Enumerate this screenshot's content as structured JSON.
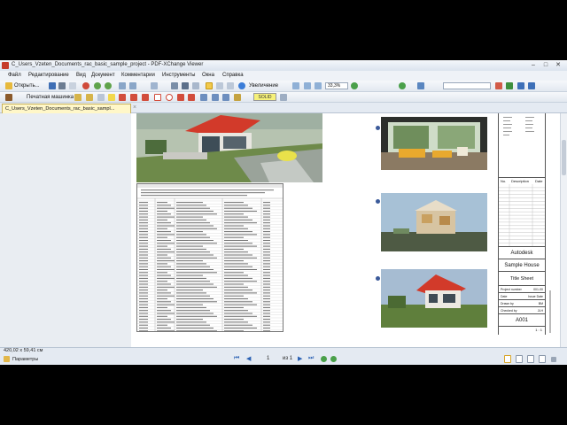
{
  "window": {
    "title": "C_Users_Vzeten_Documents_rac_basic_sample_project - PDF-XChange Viewer",
    "minimize": "–",
    "maximize": "□",
    "close": "✕"
  },
  "menu": [
    "Файл",
    "Редактирование",
    "Вид",
    "Документ",
    "Комментарии",
    "Инструменты",
    "Окна",
    "Справка"
  ],
  "toolbar": {
    "open_label": "Открыть...",
    "zoom_label": "Увеличение",
    "zoom_value": "33,3%",
    "typewriter_label": "Печатная машинка",
    "solid_label": "SOLID"
  },
  "tab": {
    "label": "C_Users_Vzeten_Documents_rac_basic_sampl...",
    "close": "×"
  },
  "titleblock": {
    "company": "Autodesk",
    "project": "Sample House",
    "sheet_title": "Title Sheet",
    "project_number_label": "Project number",
    "project_number": "001-00",
    "date_label": "Date",
    "date": "Issue Date",
    "drawn_by_label": "Drawn by",
    "drawn_by": "BM",
    "checked_by_label": "Checked by",
    "checked_by": "JLH",
    "sheet_number": "A001",
    "scale": "1 : 1",
    "revision_headers": [
      "No.",
      "Description",
      "Date"
    ]
  },
  "status": {
    "dimensions": "420,02 x 59,41 см",
    "params_label": "Параметры",
    "page": "1",
    "page_of": "из 1"
  },
  "colors": {
    "accent": "#2c62b4",
    "tab_bg": "#fff7c8",
    "roof": "#d23a2a",
    "window_bg": "#dfe6ef"
  }
}
